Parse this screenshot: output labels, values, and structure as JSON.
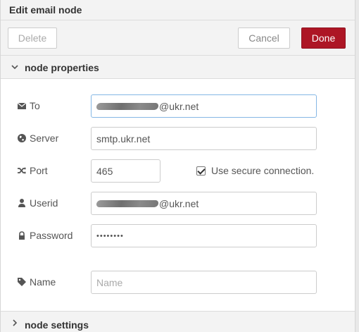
{
  "tray": {
    "title": "Edit email node"
  },
  "toolbar": {
    "delete_label": "Delete",
    "cancel_label": "Cancel",
    "done_label": "Done"
  },
  "sections": {
    "properties_label": "node properties",
    "settings_label": "node settings"
  },
  "form": {
    "to": {
      "label": "To",
      "value_visible": "@ukr.net"
    },
    "server": {
      "label": "Server",
      "value": "smtp.ukr.net"
    },
    "port": {
      "label": "Port",
      "value": "465"
    },
    "secure": {
      "label": "Use secure connection.",
      "checked": true
    },
    "userid": {
      "label": "Userid",
      "value_visible": "@ukr.net"
    },
    "password": {
      "label": "Password",
      "value": "••••••••"
    },
    "name": {
      "label": "Name",
      "placeholder": "Name",
      "value": ""
    }
  },
  "colors": {
    "done_button": "#ad1625",
    "focus_border": "#85b7e5"
  }
}
